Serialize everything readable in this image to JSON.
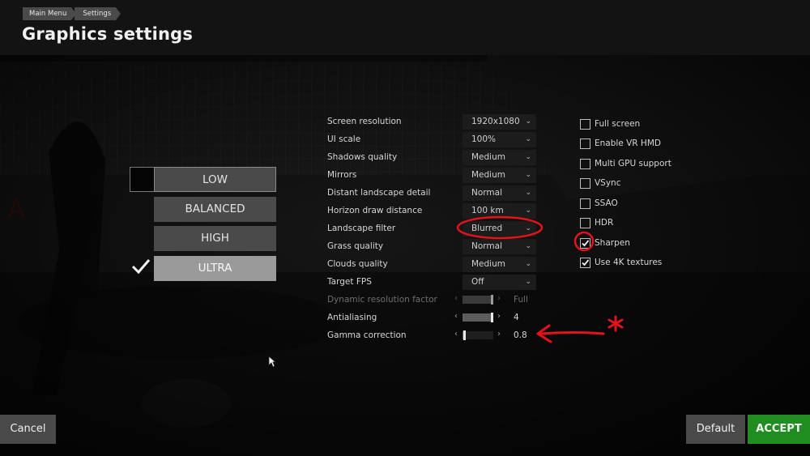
{
  "breadcrumb": [
    "Main Menu",
    "Settings"
  ],
  "title": "Graphics settings",
  "presets": {
    "items": [
      "LOW",
      "BALANCED",
      "HIGH",
      "ULTRA"
    ],
    "selected": "ULTRA"
  },
  "settings": [
    {
      "label": "Screen resolution",
      "type": "dropdown",
      "value": "1920x1080"
    },
    {
      "label": "UI scale",
      "type": "dropdown",
      "value": "100%"
    },
    {
      "label": "Shadows quality",
      "type": "dropdown",
      "value": "Medium"
    },
    {
      "label": "Mirrors",
      "type": "dropdown",
      "value": "Medium"
    },
    {
      "label": "Distant landscape detail",
      "type": "dropdown",
      "value": "Normal"
    },
    {
      "label": "Horizon draw distance",
      "type": "dropdown",
      "value": "100 km"
    },
    {
      "label": "Landscape filter",
      "type": "dropdown",
      "value": "Blurred"
    },
    {
      "label": "Grass quality",
      "type": "dropdown",
      "value": "Normal"
    },
    {
      "label": "Clouds quality",
      "type": "dropdown",
      "value": "Medium"
    },
    {
      "label": "Target FPS",
      "type": "dropdown",
      "value": "Off"
    },
    {
      "label": "Dynamic resolution factor",
      "type": "slider",
      "value": "Full",
      "level": 1.0,
      "disabled": true
    },
    {
      "label": "Antialiasing",
      "type": "slider",
      "value": "4",
      "level": 1.0
    },
    {
      "label": "Gamma correction",
      "type": "slider",
      "value": "0.8",
      "level": 0.05
    }
  ],
  "options": [
    {
      "label": "Full screen",
      "checked": false
    },
    {
      "label": "Enable VR HMD",
      "checked": false
    },
    {
      "label": "Multi GPU support",
      "checked": false
    },
    {
      "label": "VSync",
      "checked": false
    },
    {
      "label": "SSAO",
      "checked": false
    },
    {
      "label": "HDR",
      "checked": false
    },
    {
      "label": "Sharpen",
      "checked": true
    },
    {
      "label": "Use 4K textures",
      "checked": true
    }
  ],
  "buttons": {
    "cancel": "Cancel",
    "default": "Default",
    "accept": "ACCEPT"
  },
  "icons": {
    "arrow_left": "‹",
    "arrow_right": "›",
    "chevron": "⌄"
  },
  "colors": {
    "accept": "#1f8d1f",
    "annotation": "#e3121b",
    "panel": "#4a4a4a"
  }
}
